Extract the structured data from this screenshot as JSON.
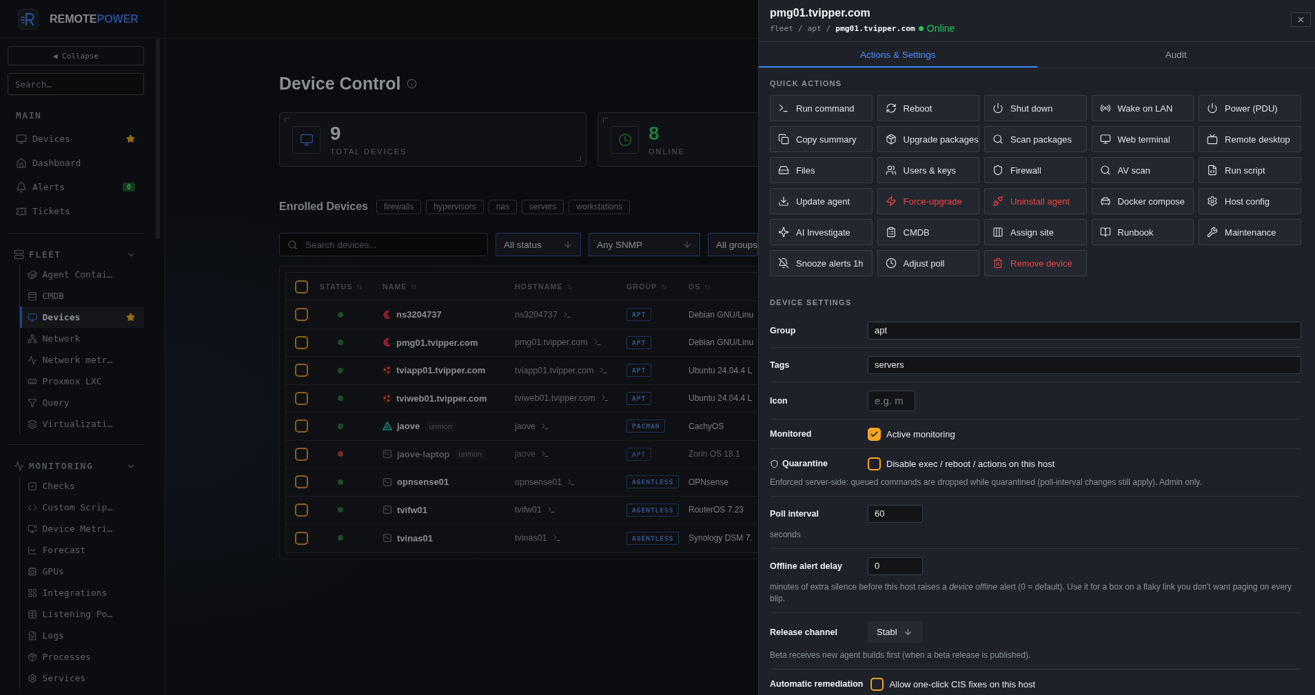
{
  "brand": {
    "parts": [
      "REMOTE",
      "POWER"
    ]
  },
  "sidebar": {
    "collapse_label": "◀ Collapse",
    "search": {
      "placeholder": "Search…"
    },
    "main": {
      "title": "MAIN",
      "items": [
        {
          "label": "Devices",
          "starred": true,
          "selected": false
        },
        {
          "label": "Dashboard",
          "starred": false,
          "selected": false
        },
        {
          "label": "Alerts",
          "starred": false,
          "selected": false,
          "badge": "0"
        },
        {
          "label": "Tickets",
          "starred": false,
          "selected": false
        }
      ]
    },
    "sections": [
      {
        "title": "FLEET",
        "expanded": true,
        "children": [
          {
            "label": "Agent Contai…",
            "starred": false,
            "selected": false
          },
          {
            "label": "CMDB",
            "starred": false,
            "selected": false
          },
          {
            "label": "Devices",
            "starred": true,
            "selected": true
          },
          {
            "label": "Network",
            "starred": false,
            "selected": false
          },
          {
            "label": "Network metr…",
            "starred": false,
            "selected": false
          },
          {
            "label": "Proxmox LXC",
            "starred": false,
            "selected": false
          },
          {
            "label": "Query",
            "starred": false,
            "selected": false
          },
          {
            "label": "Virtualizati…",
            "starred": false,
            "selected": false
          }
        ]
      },
      {
        "title": "MONITORING",
        "expanded": true,
        "children": [
          {
            "label": "Checks",
            "starred": false,
            "selected": false
          },
          {
            "label": "Custom Scrip…",
            "starred": false,
            "selected": false
          },
          {
            "label": "Device Metri…",
            "starred": false,
            "selected": false
          },
          {
            "label": "Forecast",
            "starred": false,
            "selected": false
          },
          {
            "label": "GPUs",
            "starred": false,
            "selected": false
          },
          {
            "label": "Integrations",
            "starred": false,
            "selected": false
          },
          {
            "label": "Listening Po…",
            "starred": false,
            "selected": false
          },
          {
            "label": "Logs",
            "starred": false,
            "selected": false
          },
          {
            "label": "Processes",
            "starred": false,
            "selected": false
          },
          {
            "label": "Services",
            "starred": false,
            "selected": false
          }
        ]
      }
    ]
  },
  "page": {
    "title": "Device Control",
    "stats": [
      {
        "kind": "total",
        "value": "9",
        "label": "TOTAL DEVICES"
      },
      {
        "kind": "online",
        "value": "8",
        "label": "ONLINE"
      }
    ],
    "enrolled": {
      "title": "Enrolled Devices",
      "tags": [
        "firewalls",
        "hypervisors",
        "nas",
        "servers",
        "workstations"
      ]
    },
    "filters": {
      "search": {
        "placeholder": "Search devices..."
      },
      "selects": [
        "All status",
        "Any SNMP",
        "All groups"
      ]
    },
    "table": {
      "select_all": {
        "checked": false
      },
      "columns": [
        "STATUS",
        "NAME",
        "HOSTNAME",
        "GROUP",
        "OS"
      ],
      "rows": [
        {
          "checked": false,
          "online": true,
          "kind": "debian",
          "name": "ns3204737",
          "hostname": "ns3204737",
          "group": "APT",
          "os": "Debian GNU/Linu"
        },
        {
          "checked": false,
          "online": true,
          "kind": "debian",
          "name": "pmg01.tvipper.com",
          "hostname": "pmg01.tvipper.com",
          "group": "APT",
          "os": "Debian GNU/Linu"
        },
        {
          "checked": false,
          "online": true,
          "kind": "ubuntu",
          "name": "tviapp01.tvipper.com",
          "hostname": "tviapp01.tvipper.com",
          "group": "APT",
          "os": "Ubuntu 24.04.4 L"
        },
        {
          "checked": false,
          "online": true,
          "kind": "ubuntu",
          "name": "tviweb01.tvipper.com",
          "hostname": "tviweb01.tvipper.com",
          "group": "APT",
          "os": "Ubuntu 24.04.4 L"
        },
        {
          "checked": false,
          "online": true,
          "kind": "cachyos",
          "name": "jaove",
          "badge": "unmon",
          "hostname": "jaove",
          "group": "PACMAN",
          "os": "CachyOS"
        },
        {
          "checked": false,
          "online": false,
          "kind": "generic",
          "name": "jaove-laptop",
          "badge": "unmon",
          "hostname": "jaove",
          "group": "APT",
          "os": "Zorin OS 18.1"
        },
        {
          "checked": false,
          "online": true,
          "kind": "generic",
          "name": "opnsense01",
          "hostname": "opnsense01",
          "group": "AGENTLESS",
          "os": "OPNsense"
        },
        {
          "checked": false,
          "online": true,
          "kind": "generic",
          "name": "tvifw01",
          "hostname": "tvifw01",
          "group": "AGENTLESS",
          "os": "RouterOS 7.23"
        },
        {
          "checked": false,
          "online": true,
          "kind": "generic",
          "name": "tvinas01",
          "hostname": "tvinas01",
          "group": "AGENTLESS",
          "os": "Synology DSM 7."
        }
      ]
    }
  },
  "drawer": {
    "title": "pmg01.tvipper.com",
    "breadcrumb": "fleet / apt / **pmg01.tvipper.com**",
    "status": {
      "label": "Online",
      "online": true
    },
    "tabs": [
      {
        "label": "Actions & Settings",
        "selected": true
      },
      {
        "label": "Audit",
        "selected": false
      }
    ],
    "quick_actions": {
      "title": "QUICK ACTIONS",
      "items": [
        {
          "label": "Run command",
          "danger": false
        },
        {
          "label": "Reboot",
          "danger": false
        },
        {
          "label": "Shut down",
          "danger": false
        },
        {
          "label": "Wake on LAN",
          "danger": false
        },
        {
          "label": "Power (PDU)",
          "danger": false
        },
        {
          "label": "Copy summary",
          "danger": false
        },
        {
          "label": "Upgrade packages",
          "danger": false
        },
        {
          "label": "Scan packages",
          "danger": false
        },
        {
          "label": "Web terminal",
          "danger": false
        },
        {
          "label": "Remote desktop",
          "danger": false
        },
        {
          "label": "Files",
          "danger": false
        },
        {
          "label": "Users & keys",
          "danger": false
        },
        {
          "label": "Firewall",
          "danger": false
        },
        {
          "label": "AV scan",
          "danger": false
        },
        {
          "label": "Run script",
          "danger": false
        },
        {
          "label": "Update agent",
          "danger": false
        },
        {
          "label": "Force-upgrade",
          "danger": true
        },
        {
          "label": "Uninstall agent",
          "danger": true
        },
        {
          "label": "Docker compose",
          "danger": false
        },
        {
          "label": "Host config",
          "danger": false
        },
        {
          "label": "AI Investigate",
          "danger": false
        },
        {
          "label": "CMDB",
          "danger": false
        },
        {
          "label": "Assign site",
          "danger": false
        },
        {
          "label": "Runbook",
          "danger": false
        },
        {
          "label": "Maintenance",
          "danger": false
        },
        {
          "label": "Snooze alerts 1h",
          "danger": false
        },
        {
          "label": "Adjust poll",
          "danger": false
        },
        {
          "label": "Remove device",
          "danger": true
        }
      ]
    },
    "settings": {
      "title": "DEVICE SETTINGS",
      "rows": [
        {
          "kind": "text",
          "label": "Group",
          "value": "apt"
        },
        {
          "kind": "text",
          "label": "Tags",
          "value": "servers"
        },
        {
          "kind": "short",
          "label": "Icon",
          "placeholder": "e.g. m"
        },
        {
          "kind": "checkbox",
          "label": "Monitored",
          "checked": true,
          "text": "Active monitoring"
        },
        {
          "kind": "guarded",
          "label": "Quarantine",
          "checked": false,
          "text": "Disable exec / reboot / actions on this host",
          "help": "Enforced server-side: queued commands are dropped while quarantined (poll-interval changes still apply). Admin only."
        },
        {
          "kind": "number",
          "label": "Poll interval",
          "value": "60",
          "help": "seconds"
        },
        {
          "kind": "number",
          "label": "Offline alert delay",
          "value": "0",
          "help": "minutes of extra silence before this host raises a *device offline* alert (0 = default). Use it for a box on a flaky link you don't want paging on every blip."
        },
        {
          "kind": "select",
          "label": "Release channel",
          "value": "Stabl",
          "help": "Beta receives new agent builds first (when a beta release is published)."
        },
        {
          "kind": "checkbox",
          "label": "Automatic remediation",
          "checked": false,
          "text": "Allow one-click CIS fixes on this host"
        }
      ]
    }
  }
}
